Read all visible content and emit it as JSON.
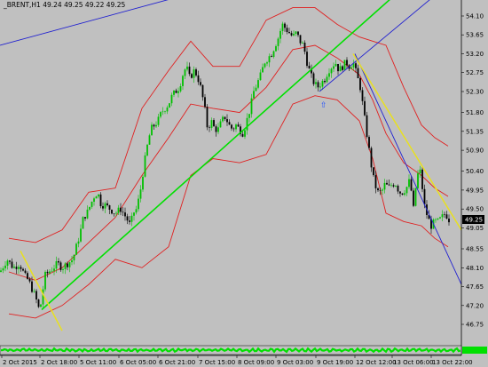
{
  "chart_data": {
    "type": "candlestick",
    "symbol_header": "_BRENT,H1  49.24 49.25 49.22 49.25",
    "price_axis": {
      "min": 46.75,
      "max": 54.1,
      "ticks": [
        "54.10",
        "53.65",
        "53.20",
        "52.75",
        "52.30",
        "51.80",
        "51.35",
        "50.90",
        "50.40",
        "49.95",
        "49.50",
        "49.05",
        "48.55",
        "48.10",
        "47.65",
        "47.20",
        "46.75"
      ],
      "current_price": "49.25"
    },
    "time_axis": {
      "labels": [
        "2 Oct 2015",
        "2 Oct 18:00",
        "5 Oct 11:00",
        "6 Oct 05:00",
        "6 Oct 21:00",
        "7 Oct 15:00",
        "8 Oct 09:00",
        "9 Oct 03:00",
        "9 Oct 19:00",
        "12 Oct 12:00",
        "13 Oct 06:00",
        "13 Oct 22:00"
      ]
    },
    "close_path": [
      [
        0,
        48.0
      ],
      [
        8,
        48.3
      ],
      [
        15,
        48.1
      ],
      [
        22,
        48.2
      ],
      [
        28,
        47.9
      ],
      [
        32,
        47.8
      ],
      [
        36,
        47.6
      ],
      [
        40,
        47.4
      ],
      [
        44,
        47.1
      ],
      [
        47,
        47.3
      ],
      [
        50,
        47.9
      ],
      [
        55,
        48.0
      ],
      [
        60,
        48.1
      ],
      [
        65,
        48.2
      ],
      [
        70,
        48.1
      ],
      [
        76,
        48.2
      ],
      [
        82,
        48.3
      ],
      [
        86,
        48.6
      ],
      [
        90,
        48.9
      ],
      [
        94,
        49.3
      ],
      [
        98,
        49.4
      ],
      [
        102,
        49.6
      ],
      [
        106,
        49.8
      ],
      [
        110,
        49.9
      ],
      [
        114,
        49.6
      ],
      [
        118,
        49.6
      ],
      [
        124,
        49.5
      ],
      [
        130,
        49.4
      ],
      [
        136,
        49.5
      ],
      [
        142,
        49.3
      ],
      [
        147,
        49.1
      ],
      [
        150,
        49.4
      ],
      [
        154,
        49.5
      ],
      [
        158,
        49.9
      ],
      [
        162,
        50.5
      ],
      [
        166,
        51.0
      ],
      [
        170,
        51.4
      ],
      [
        174,
        51.5
      ],
      [
        178,
        51.6
      ],
      [
        182,
        51.8
      ],
      [
        186,
        51.9
      ],
      [
        190,
        52.0
      ],
      [
        194,
        52.2
      ],
      [
        198,
        52.3
      ],
      [
        202,
        52.4
      ],
      [
        206,
        52.7
      ],
      [
        210,
        52.9
      ],
      [
        214,
        52.6
      ],
      [
        218,
        52.8
      ],
      [
        222,
        52.7
      ],
      [
        226,
        52.4
      ],
      [
        230,
        52.0
      ],
      [
        234,
        51.4
      ],
      [
        238,
        51.6
      ],
      [
        242,
        51.4
      ],
      [
        246,
        51.4
      ],
      [
        250,
        51.6
      ],
      [
        254,
        51.7
      ],
      [
        258,
        51.5
      ],
      [
        262,
        51.4
      ],
      [
        266,
        51.5
      ],
      [
        270,
        51.4
      ],
      [
        274,
        51.3
      ],
      [
        278,
        51.6
      ],
      [
        282,
        51.9
      ],
      [
        286,
        52.3
      ],
      [
        290,
        52.5
      ],
      [
        294,
        52.7
      ],
      [
        298,
        53.0
      ],
      [
        302,
        53.1
      ],
      [
        306,
        53.2
      ],
      [
        310,
        53.4
      ],
      [
        314,
        53.6
      ],
      [
        318,
        53.9
      ],
      [
        322,
        53.8
      ],
      [
        326,
        53.7
      ],
      [
        330,
        53.6
      ],
      [
        334,
        53.7
      ],
      [
        338,
        53.5
      ],
      [
        342,
        53.4
      ],
      [
        346,
        53.0
      ],
      [
        350,
        52.7
      ],
      [
        354,
        52.5
      ],
      [
        358,
        52.4
      ],
      [
        362,
        52.5
      ],
      [
        366,
        52.6
      ],
      [
        370,
        52.8
      ],
      [
        374,
        52.9
      ],
      [
        378,
        53.0
      ],
      [
        382,
        52.8
      ],
      [
        386,
        52.9
      ],
      [
        390,
        53.0
      ],
      [
        394,
        52.9
      ],
      [
        398,
        53.0
      ],
      [
        402,
        52.7
      ],
      [
        406,
        52.4
      ],
      [
        410,
        51.8
      ],
      [
        414,
        51.2
      ],
      [
        418,
        50.6
      ],
      [
        422,
        50.1
      ],
      [
        426,
        49.9
      ],
      [
        430,
        49.9
      ],
      [
        434,
        50.1
      ],
      [
        438,
        50.0
      ],
      [
        442,
        50.1
      ],
      [
        446,
        50.1
      ],
      [
        450,
        49.9
      ],
      [
        454,
        49.9
      ],
      [
        458,
        50.0
      ],
      [
        462,
        50.2
      ],
      [
        466,
        49.5
      ],
      [
        470,
        50.3
      ],
      [
        474,
        50.4
      ],
      [
        478,
        49.6
      ],
      [
        482,
        49.3
      ],
      [
        486,
        49.1
      ],
      [
        490,
        49.2
      ],
      [
        494,
        49.2
      ],
      [
        498,
        49.3
      ],
      [
        502,
        49.4
      ],
      [
        506,
        49.25
      ]
    ],
    "series": [
      {
        "name": "",
        "kind": "bollinger-upper",
        "color": "#e02020",
        "x": [
          10,
          40,
          70,
          100,
          130,
          160,
          190,
          215,
          240,
          270,
          300,
          330,
          355,
          380,
          405,
          420,
          435,
          455,
          475,
          490,
          505
        ],
        "values": [
          48.8,
          48.7,
          49.0,
          49.9,
          50.0,
          51.9,
          52.8,
          53.5,
          52.9,
          52.9,
          54.0,
          54.3,
          54.3,
          53.9,
          53.6,
          53.5,
          53.4,
          52.4,
          51.5,
          51.2,
          51.0
        ]
      },
      {
        "name": "",
        "kind": "bollinger-middle",
        "color": "#e02020",
        "x": [
          10,
          40,
          70,
          100,
          130,
          160,
          190,
          215,
          240,
          270,
          300,
          330,
          355,
          380,
          405,
          420,
          435,
          455,
          475,
          490,
          505
        ],
        "values": [
          48.0,
          47.8,
          48.1,
          48.7,
          49.3,
          50.3,
          51.2,
          52.0,
          51.9,
          51.8,
          52.4,
          53.3,
          53.4,
          53.1,
          52.7,
          52.1,
          51.3,
          50.6,
          50.3,
          50.0,
          49.8
        ]
      },
      {
        "name": "",
        "kind": "bollinger-lower",
        "color": "#e02020",
        "x": [
          10,
          40,
          70,
          100,
          130,
          160,
          190,
          215,
          240,
          270,
          300,
          330,
          355,
          380,
          405,
          420,
          435,
          455,
          475,
          490,
          505
        ],
        "values": [
          47.0,
          46.9,
          47.2,
          47.7,
          48.3,
          48.1,
          48.6,
          50.3,
          50.7,
          50.6,
          50.8,
          52.0,
          52.2,
          52.1,
          51.6,
          50.7,
          49.4,
          49.2,
          49.1,
          48.8,
          48.6
        ]
      }
    ],
    "trendlines": [
      {
        "color": "#2020d0",
        "from": [
          0,
          53.4
        ],
        "to": [
          226,
          54.7
        ]
      },
      {
        "color": "#00e000",
        "from": [
          47,
          47.1
        ],
        "to": [
          445,
          54.6
        ]
      },
      {
        "color": "#2020d0",
        "from": [
          360,
          52.3
        ],
        "to": [
          485,
          54.5
        ]
      },
      {
        "color": "#2020d0",
        "from": [
          400,
          53.2
        ],
        "to": [
          520,
          47.7
        ]
      },
      {
        "color": "#e8e020",
        "from": [
          398,
          53.2
        ],
        "to": [
          520,
          49.0
        ]
      },
      {
        "color": "#e8e020",
        "from": [
          23,
          48.5
        ],
        "to": [
          70,
          46.6
        ]
      }
    ],
    "arrow_marker": {
      "x": 364,
      "y": 52.0,
      "symbol": "⇧",
      "color": "#2050ff"
    },
    "indicator_panel": {
      "color": "#00e000"
    },
    "colors": {
      "bull": "#00c000",
      "bear": "#000000",
      "background": "#c0c0c0",
      "bollinger": "#e02020",
      "price_tag_bg": "#000000",
      "price_tag_text": "#ffffff"
    }
  }
}
